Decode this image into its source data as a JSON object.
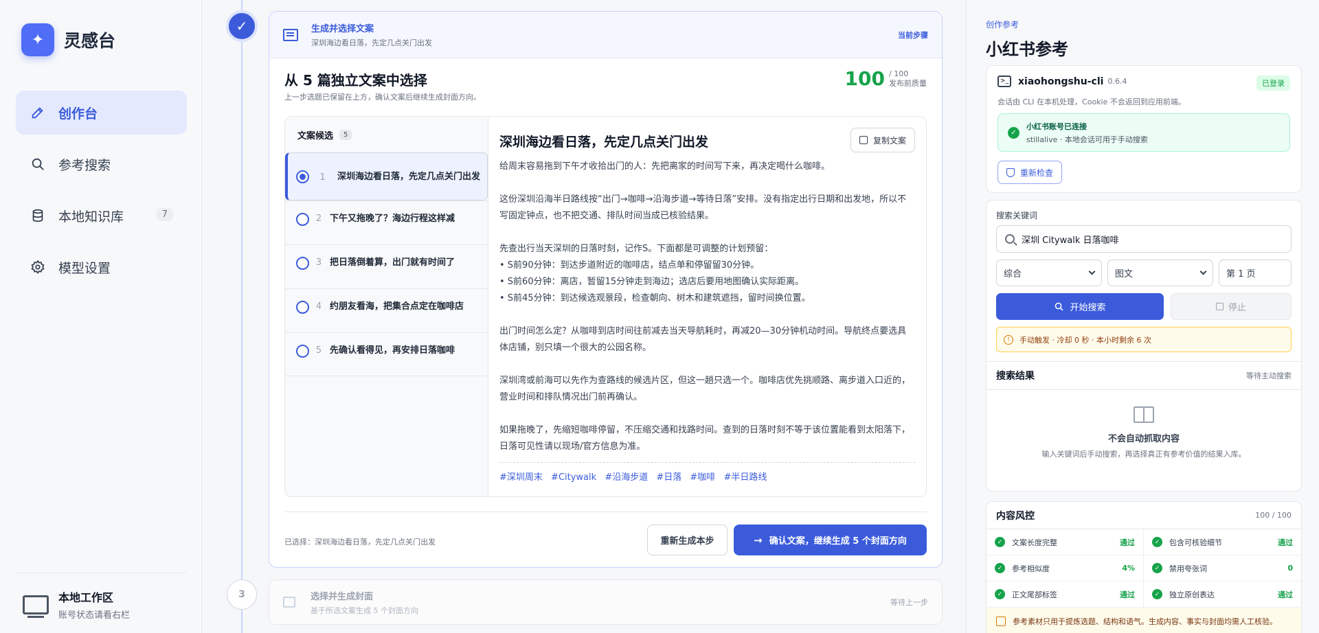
{
  "app": {
    "name": "灵感台"
  },
  "sidebar": {
    "items": [
      {
        "label": "创作台",
        "icon": "pencil-icon",
        "active": true
      },
      {
        "label": "参考搜索",
        "icon": "search-icon"
      },
      {
        "label": "本地知识库",
        "icon": "database-icon",
        "count": "7"
      },
      {
        "label": "模型设置",
        "icon": "gear-icon"
      }
    ],
    "workspace": {
      "title": "本地工作区",
      "subtitle": "账号状态请看右栏"
    }
  },
  "step2": {
    "title": "生成并选择文案",
    "subtitle": "深圳海边看日落，先定几点关门出发",
    "status": "当前步骤",
    "section_title": "从 5 篇独立文案中选择",
    "section_sub": "上一步选题已保留在上方，确认文案后继续生成封面方向。",
    "score": "100",
    "score_max": "/ 100",
    "score_label": "发布前质量",
    "candidates_label": "文案候选",
    "candidates_count": "5",
    "candidates": [
      {
        "num": "1",
        "text": "深圳海边看日落，先定几点关门出发",
        "selected": true
      },
      {
        "num": "2",
        "text": "下午又拖晚了？海边行程这样减"
      },
      {
        "num": "3",
        "text": "把日落倒着算，出门就有时间了"
      },
      {
        "num": "4",
        "text": "约朋友看海，把集合点定在咖啡店"
      },
      {
        "num": "5",
        "text": "先确认看得见，再安排日落咖啡"
      }
    ],
    "article": {
      "title": "深圳海边看日落，先定几点关门出发",
      "copy_label": "复制文案",
      "p1": "给周末容易拖到下午才收拾出门的人：先把离家的时间写下来，再决定喝什么咖啡。",
      "p2": "这份深圳沿海半日路线按“出门→咖啡→沿海步道→等待日落”安排。没有指定出行日期和出发地，所以不写固定钟点，也不把交通、排队时间当成已核验结果。",
      "p3": "先查出行当天深圳的日落时刻，记作S。下面都是可调整的计划预留：",
      "b1": "• S前90分钟：到达步道附近的咖啡店，结点单和停留留30分钟。",
      "b2": "• S前60分钟：离店，暂留15分钟走到海边；选店后要用地图确认实际距离。",
      "b3": "• S前45分钟：到达候选观景段，检查朝向、树木和建筑遮挡，留时间换位置。",
      "p4": "出门时间怎么定？从咖啡到店时间往前减去当天导航耗时，再减20—30分钟机动时间。导航终点要选具体店铺，别只填一个很大的公园名称。",
      "p5": "深圳湾或前海可以先作为查路线的候选片区，但这一趟只选一个。咖啡店优先挑顺路、离步道入口近的，营业时间和排队情况出门前再确认。",
      "p6": "如果拖晚了，先缩短咖啡停留，不压缩交通和找路时间。查到的日落时刻不等于该位置能看到太阳落下，日落可见性请以现场/官方信息为准。",
      "tags": [
        "#深圳周末",
        "#Citywalk",
        "#沿海步道",
        "#日落",
        "#咖啡",
        "#半日路线"
      ]
    },
    "selected_info": "已选择：深圳海边看日落，先定几点关门出发",
    "regen_label": "重新生成本步",
    "confirm_label": "确认文案，继续生成 5 个封面方向"
  },
  "step3": {
    "num": "3",
    "title": "选择并生成封面",
    "subtitle": "基于所选文案生成 5 个封面方向",
    "status": "等待上一步"
  },
  "right": {
    "eyebrow": "创作参考",
    "title": "小红书参考",
    "cli": {
      "name": "xiaohongshu-cli",
      "version": "0.6.4",
      "status": "已登录",
      "desc": "会话由 CLI 在本机处理，Cookie 不会返回到应用前端。",
      "conn_title": "小红书账号已连接",
      "conn_sub": "stillalive · 本地会话可用于手动搜索",
      "recheck_label": "重新检查"
    },
    "search": {
      "label": "搜索关键词",
      "value": "深圳 Citywalk 日落咖啡",
      "sort": "综合",
      "type": "图文",
      "page": "第 1 页",
      "search_label": "开始搜索",
      "stop_label": "停止",
      "warning": "手动触发 · 冷却 0 秒 · 本小时剩余 6 次",
      "results_title": "搜索结果",
      "results_status": "等待主动搜索",
      "empty_title": "不会自动抓取内容",
      "empty_sub": "输入关键词后手动搜索，再选择真正有参考价值的结果入库。"
    },
    "risk": {
      "title": "内容风控",
      "score": "100 / 100",
      "checks": [
        {
          "label": "文案长度完整",
          "value": "通过"
        },
        {
          "label": "包含可核验细节",
          "value": "通过"
        },
        {
          "label": "参考相似度",
          "value": "4%"
        },
        {
          "label": "禁用夸张词",
          "value": "0"
        },
        {
          "label": "正文尾部标签",
          "value": "通过"
        },
        {
          "label": "独立原创表达",
          "value": "通过"
        }
      ],
      "note": "参考素材只用于提炼选题、结构和语气。生成内容、事实与封面均需人工核验。"
    }
  }
}
